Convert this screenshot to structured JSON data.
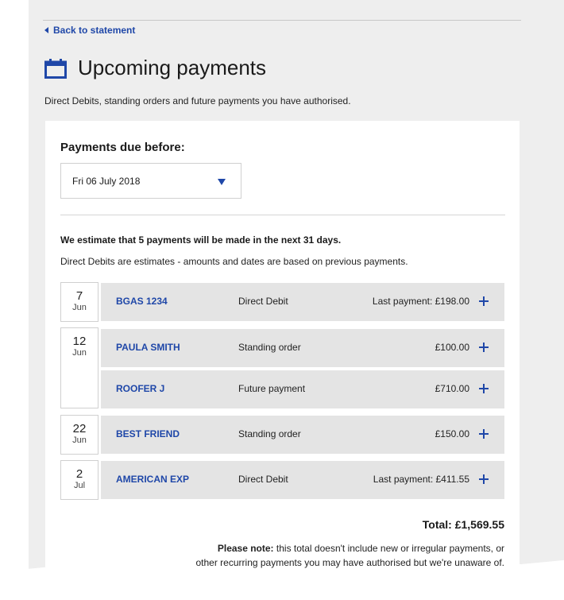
{
  "nav": {
    "back_label": "Back to statement"
  },
  "header": {
    "title": "Upcoming payments",
    "subtitle": "Direct Debits, standing orders and future payments you have authorised."
  },
  "filter": {
    "label": "Payments due before:",
    "selected_date": "Fri 06 July 2018"
  },
  "summary": {
    "estimate": "We estimate that 5 payments will be made in the next 31 days.",
    "note": "Direct Debits are estimates - amounts and dates are based on previous payments."
  },
  "dates": [
    {
      "day": "7",
      "month": "Jun"
    },
    {
      "day": "12",
      "month": "Jun"
    },
    {
      "day": "22",
      "month": "Jun"
    },
    {
      "day": "2",
      "month": "Jul"
    }
  ],
  "payments": [
    {
      "payee": "BGAS 1234",
      "type": "Direct Debit",
      "amount": "Last payment: £198.00"
    },
    {
      "payee": "PAULA SMITH",
      "type": "Standing order",
      "amount": "£100.00"
    },
    {
      "payee": "ROOFER J",
      "type": "Future payment",
      "amount": "£710.00"
    },
    {
      "payee": "BEST FRIEND",
      "type": "Standing order",
      "amount": "£150.00"
    },
    {
      "payee": "AMERICAN  EXP",
      "type": "Direct Debit",
      "amount": "Last payment: £411.55"
    }
  ],
  "footer": {
    "total": "Total: £1,569.55",
    "note_bold": "Please note:",
    "note_line1": " this total doesn't include new or irregular payments, or",
    "note_line2": "other recurring payments you may have authorised but we're unaware of."
  },
  "colors": {
    "link_blue": "#1f47a8",
    "sheet_gray": "#eeeeee",
    "row_gray": "#e4e4e4"
  }
}
